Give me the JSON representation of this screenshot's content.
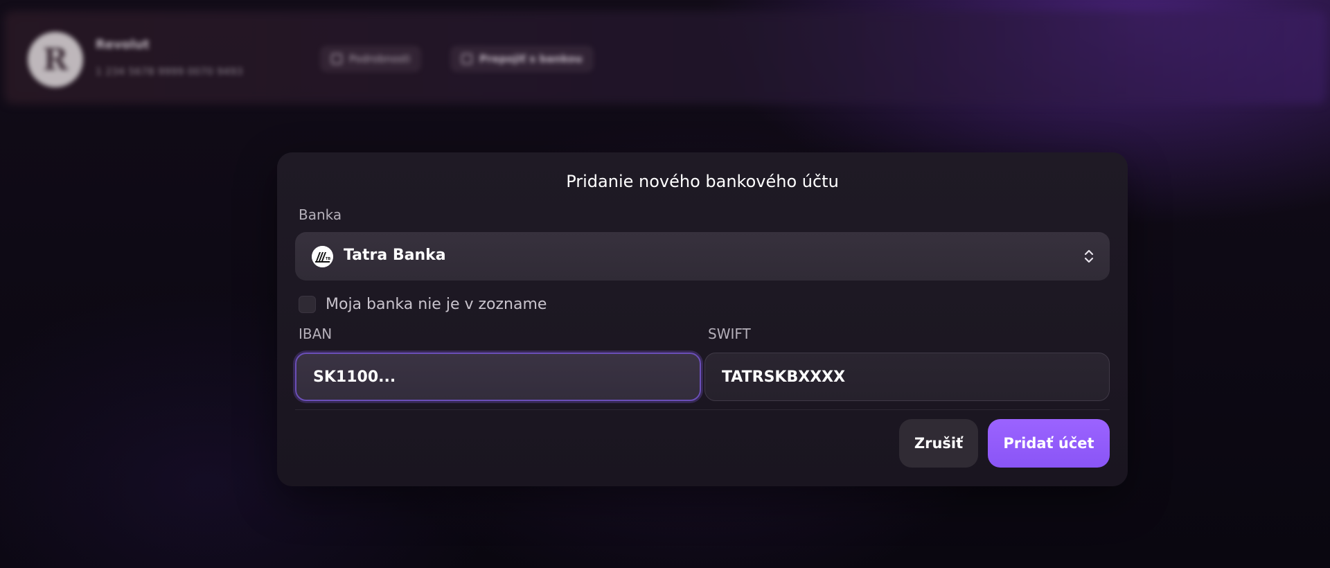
{
  "background": {
    "profile_name": "Revolut",
    "profile_sub": "1 234 5678 9999 0070 9493",
    "action_1_label": "Podrobnosti",
    "action_2_label": "Prepojiť s bankou",
    "avatar_letter": "R"
  },
  "modal": {
    "title": "Pridanie nového bankového účtu",
    "bank_label": "Banka",
    "bank_selected": "Tatra Banka",
    "bank_logo_icon": "tatra-banka-logo",
    "select_icon": "chevron-up-down-icon",
    "not_listed_label": "Moja banka nie je v zozname",
    "not_listed_checked": false,
    "iban_label": "IBAN",
    "iban_value": "SK1100...",
    "swift_label": "SWIFT",
    "swift_value": "TATRSKBXXXX",
    "cancel_label": "Zrušiť",
    "submit_label": "Pridať účet"
  },
  "colors": {
    "accent": "#8b5cf6",
    "modal_bg": "#1d1823",
    "input_focus_border": "#6b4fb8"
  }
}
